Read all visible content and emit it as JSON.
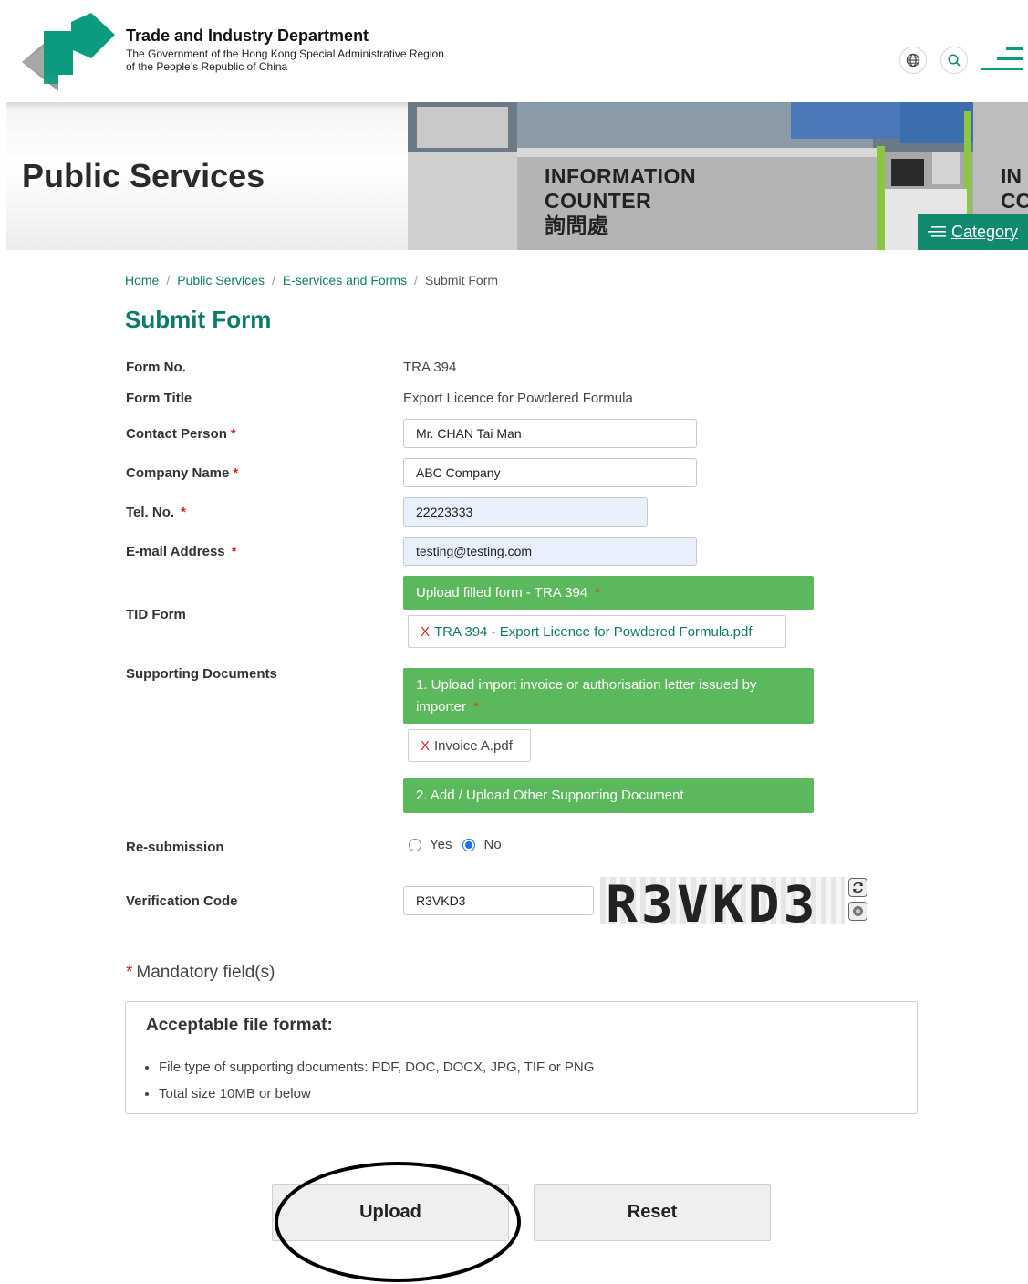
{
  "header": {
    "dept_name": "Trade and Industry Department",
    "gov_line1": "The Government of the Hong Kong Special Administrative Region",
    "gov_line2": "of the People’s Republic of China",
    "icons": [
      "globe-icon",
      "search-icon",
      "menu-icon"
    ]
  },
  "banner": {
    "page_title": "Public Services",
    "photo_text": [
      "INFORMATION",
      "COUNTER",
      "詢問處"
    ],
    "photo_text_right": [
      "IN",
      "CC"
    ],
    "category_label": "Category"
  },
  "breadcrumb": {
    "home": "Home",
    "sep": "/",
    "public_services": "Public Services",
    "eservices": "E-services and Forms",
    "current": "Submit Form"
  },
  "form": {
    "title": "Submit Form",
    "required_mark": "*",
    "form_no_label": "Form No.",
    "form_no_value": "TRA 394",
    "form_title_label": "Form Title",
    "form_title_value": "Export Licence for Powdered Formula",
    "contact_label": "Contact Person",
    "contact_value": "Mr. CHAN Tai Man",
    "company_label": "Company Name",
    "company_value": "ABC Company",
    "tel_label": "Tel. No.",
    "tel_value": "22223333",
    "email_label": "E-mail Address",
    "email_value": "testing@testing.com",
    "tid_label": "TID Form",
    "upload_filled_label": "Upload filled form - TRA 394",
    "tid_file": "TRA 394 - Export Licence for Powdered Formula.pdf",
    "remove_mark": "X",
    "supporting_label": "Supporting Documents",
    "upload_invoice_label_1": "1. Upload import invoice or authorisation letter issued by",
    "upload_invoice_label_2": "importer",
    "invoice_file": "Invoice A.pdf",
    "upload_other_label": "2. Add / Upload Other Supporting Document",
    "resubmission_label": "Re-submission",
    "yes_label": "Yes",
    "no_label": "No",
    "resubmission_selected": "No",
    "verification_label": "Verification Code",
    "verification_value": "R3VKD3",
    "captcha_text": "R3VKD3"
  },
  "mandatory_note": "Mandatory field(s)",
  "info": {
    "title": "Acceptable file format:",
    "items": [
      "File type of supporting documents: PDF, DOC, DOCX, JPG, TIF or PNG",
      "Total size 10MB or below"
    ]
  },
  "actions": {
    "upload": "Upload",
    "reset": "Reset"
  },
  "colors": {
    "teal": "#0c7b68",
    "green_button": "#5cb85c",
    "category_bg": "#0f8a6e",
    "required": "#e02020",
    "autofill_bg": "#e8f0fe"
  }
}
